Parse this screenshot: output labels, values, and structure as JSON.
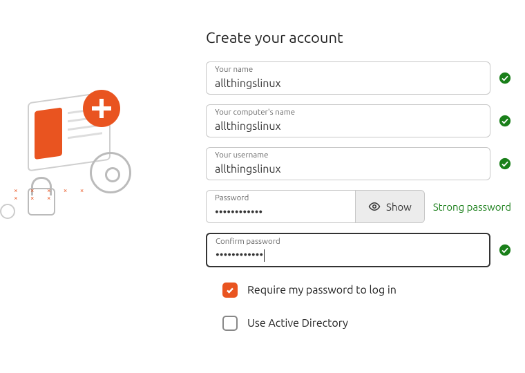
{
  "title": "Create your account",
  "fields": {
    "name": {
      "label": "Your name",
      "value": "allthingslinux",
      "valid": true
    },
    "host": {
      "label": "Your computer's name",
      "value": "allthingslinux",
      "valid": true
    },
    "user": {
      "label": "Your username",
      "value": "allthingslinux",
      "valid": true
    },
    "pass": {
      "label": "Password",
      "value": "••••••••••••",
      "show_label": "Show",
      "strength": "Strong password"
    },
    "confirm": {
      "label": "Confirm password",
      "value": "••••••••••••",
      "valid": true,
      "focused": true
    }
  },
  "options": {
    "require_pw": {
      "label": "Require my password to log in",
      "checked": true
    },
    "ad": {
      "label": "Use Active Directory",
      "checked": false
    }
  },
  "colors": {
    "accent": "#e95420",
    "ok": "#1a7f1a"
  }
}
